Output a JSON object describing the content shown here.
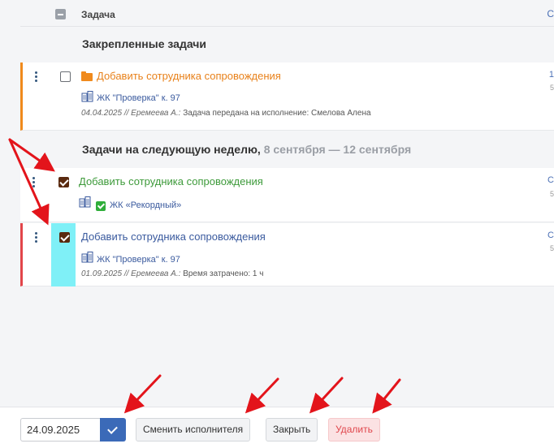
{
  "header": {
    "column_title": "Задача",
    "right_fragment": "С"
  },
  "sections": {
    "pinned_title": "Закрепленные задачи",
    "next_week_title": "Задачи на следующую неделю,",
    "next_week_dates": "8 сентября — 12 сентября"
  },
  "tasks": [
    {
      "title": "Добавить сотрудника сопровождения",
      "object": "ЖК \"Проверка\" к. 97",
      "date": "04.04.2025",
      "author": "// Еремеева А.:",
      "comment": "Задача передана на исполнение: Смелова Алена",
      "edge_top": "1",
      "edge_bottom": "5"
    },
    {
      "title": "Добавить сотрудника сопровождения",
      "object": "ЖК «Рекордный»",
      "edge_top": "С",
      "edge_bottom": "5"
    },
    {
      "title": "Добавить сотрудника сопровождения",
      "object": "ЖК \"Проверка\" к. 97",
      "date": "01.09.2025",
      "author": "// Еремеева А.:",
      "comment": "Время затрачено: 1 ч",
      "edge_top": "С",
      "edge_bottom": "5"
    }
  ],
  "bottombar": {
    "date_value": "24.09.2025",
    "change_executor_label": "Сменить исполнителя",
    "close_label": "Закрыть",
    "delete_label": "Удалить"
  },
  "colors": {
    "accent": "#3b6ab8",
    "pinned_border": "#f08a1c",
    "overdue_border": "#e2454a",
    "highlight": "#7ff0f7",
    "annotation": "#e3141b"
  },
  "icons": [
    "kebab-menu-icon",
    "folder-icon",
    "building-icon",
    "check-badge-icon",
    "checkmark-icon"
  ]
}
